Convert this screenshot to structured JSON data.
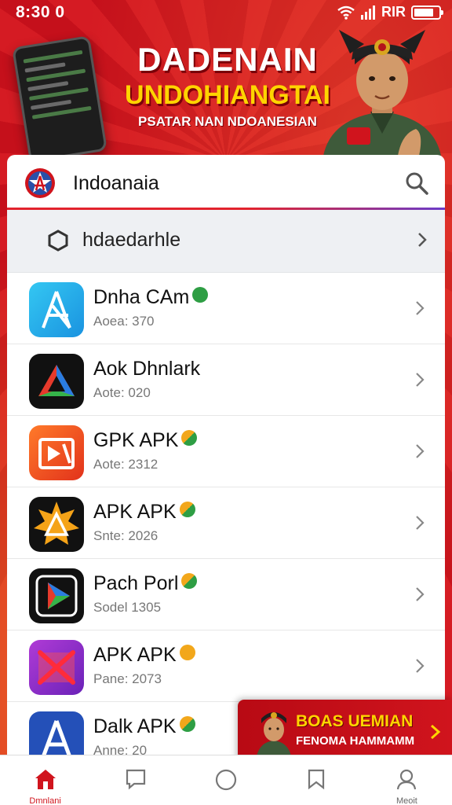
{
  "status_bar": {
    "time": "8:30 0",
    "right_text": "RIR"
  },
  "banner": {
    "title": "DADENAIN",
    "subtitle": "UNDOHIANGTAI",
    "caption": "PSATAR NAN NDOANESIAN"
  },
  "search": {
    "title": "Indoanaia",
    "icon": "search-icon",
    "logo_icon": "star-logo-icon"
  },
  "category": {
    "label": "hdaedarhle",
    "icon": "hexagon-icon"
  },
  "apps": [
    {
      "name": "Dnha CAm",
      "meta": "Aoea: 370",
      "badge_color": "#2e9e44",
      "icon": "app-a-icon"
    },
    {
      "name": "Aok Dhnlark",
      "meta": "Aote: 020",
      "badge_color": "",
      "icon": "prism-icon"
    },
    {
      "name": "GPK APK",
      "meta": "Aote: 2312",
      "badge_color": "#f2a71b",
      "icon": "play-square-icon"
    },
    {
      "name": "APK APK",
      "meta": "Snte: 2026",
      "badge_color": "#f2a71b",
      "icon": "sun-triangle-icon"
    },
    {
      "name": "Pach Porl",
      "meta": "Sodel 1305",
      "badge_color": "#f2a71b",
      "icon": "play-triangle-icon"
    },
    {
      "name": "APK APK",
      "meta": "Pane: 2073",
      "badge_color": "#f2a71b",
      "icon": "x-mark-icon"
    },
    {
      "name": "Dalk APK",
      "meta": "Anne: 20",
      "badge_color": "#f2a71b",
      "icon": "app-a-blue-icon"
    }
  ],
  "promo": {
    "title": "BOAS UEMIAN",
    "subtitle": "FENOMA HAMMAMM"
  },
  "nav": [
    {
      "label": "Dmnlani",
      "icon": "home-icon"
    },
    {
      "label": "",
      "icon": "chat-icon"
    },
    {
      "label": "",
      "icon": "circle-icon"
    },
    {
      "label": "",
      "icon": "bookmark-icon"
    },
    {
      "label": "Meoit",
      "icon": "profile-icon"
    }
  ],
  "colors": {
    "brand_red": "#d0141d",
    "accent_yellow": "#ffd400"
  }
}
